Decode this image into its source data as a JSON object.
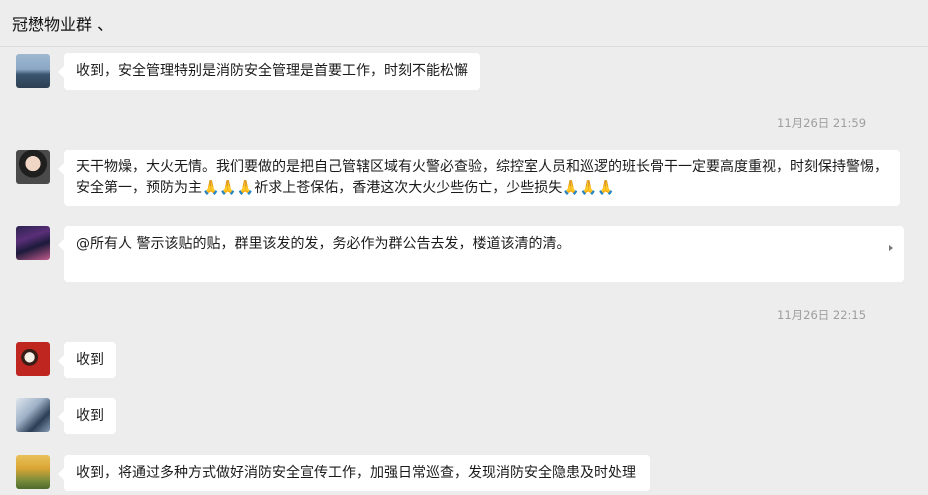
{
  "header": {
    "title": "冠懋物业群 、"
  },
  "messages": [
    {
      "text": "收到，安全管理特别是消防安全管理是首要工作，时刻不能松懈"
    },
    {
      "text": "天干物燥，大火无情。我们要做的是把自己管辖区域有火警必查验，综控室人员和巡逻的班长骨干一定要高度重视，时刻保持警惕，安全第一，预防为主🙏🙏🙏祈求上苍保佑，香港这次大火少些伤亡，少些损失🙏🙏🙏"
    },
    {
      "text": "@所有人 警示该贴的贴，群里该发的发，务必作为群公告去发，楼道该清的清。"
    },
    {
      "text": "收到"
    },
    {
      "text": "收到"
    },
    {
      "text": "收到，将通过多种方式做好消防安全宣传工作，加强日常巡查，发现消防安全隐患及时处理"
    }
  ],
  "timestamps": [
    "11月26日 21:59",
    "11月26日 22:15"
  ],
  "colors": {
    "background": "#ededed",
    "bubble": "#ffffff",
    "timestamp": "#9e9e9e"
  }
}
